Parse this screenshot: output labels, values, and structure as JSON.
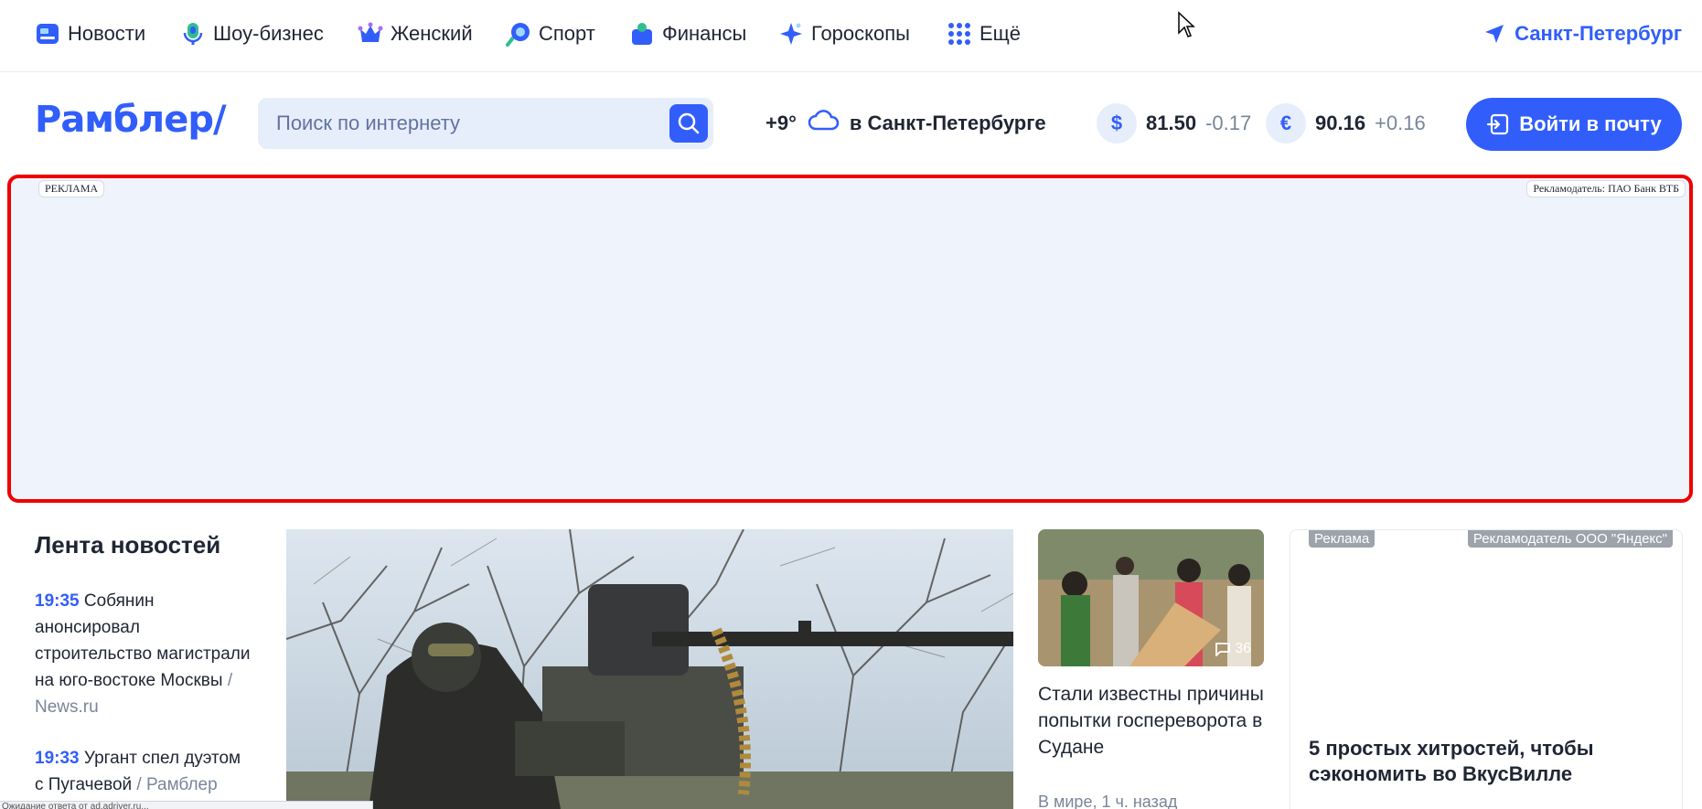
{
  "nav": {
    "items": [
      {
        "label": "Новости",
        "icon": "news-icon"
      },
      {
        "label": "Шоу-бизнес",
        "icon": "microphone-icon"
      },
      {
        "label": "Женский",
        "icon": "crown-icon"
      },
      {
        "label": "Спорт",
        "icon": "ball-icon"
      },
      {
        "label": "Финансы",
        "icon": "wallet-icon"
      },
      {
        "label": "Гороскопы",
        "icon": "star-icon"
      },
      {
        "label": "Ещё",
        "icon": "grid-icon"
      }
    ],
    "city": "Санкт-Петербург"
  },
  "header": {
    "logo": "Рамблер/",
    "search_placeholder": "Поиск по интернету",
    "weather": {
      "temp": "+9°",
      "city": "в Санкт-Петербурге"
    },
    "usd": {
      "symbol": "$",
      "value": "81.50",
      "change": "-0.17"
    },
    "eur": {
      "symbol": "€",
      "value": "90.16",
      "change": "+0.16"
    },
    "login_label": "Войти в почту"
  },
  "ad_banner": {
    "tag_left": "РЕКЛАМА",
    "tag_right": "Рекламодатель: ПАО Банк ВТБ"
  },
  "feed": {
    "title": "Лента новостей",
    "items": [
      {
        "time": "19:35",
        "text": "Собянин анонсировал строительство магистрали на юго-востоке Москвы",
        "source": "/ News.ru"
      },
      {
        "time": "19:33",
        "text": "Ургант спел дуэтом с Пугачевой",
        "source": "/ Рамблер"
      }
    ]
  },
  "side_story": {
    "comments": "36",
    "title": "Стали известны причины попытки госпереворота в Судане",
    "meta": "В мире, 1 ч. назад"
  },
  "ad_card": {
    "chip_left": "Реклама",
    "chip_right": "Рекламодатель ООО \"Яндекс\"",
    "title": "5 простых хитростей, чтобы сэкономить во ВкусВилле"
  },
  "status_bar": "Ожидание ответа от ad.adriver.ru...",
  "colors": {
    "accent": "#315efb",
    "ad_bg": "#eef3fc",
    "ad_border": "#ee0000"
  }
}
